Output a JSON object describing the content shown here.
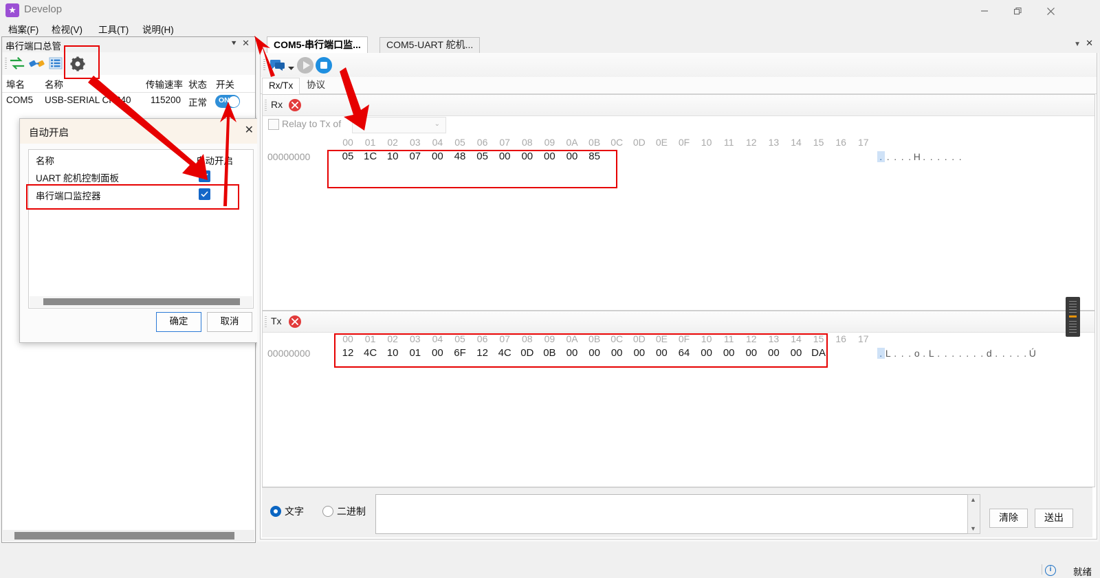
{
  "window": {
    "title": "Develop",
    "logo_icon": "star-logo-icon",
    "minimize_icon": "minimize-icon",
    "maximize_icon": "maximize-icon",
    "close_icon": "close-icon"
  },
  "menubar": {
    "items": [
      {
        "label": "档案(F)",
        "accel": "F"
      },
      {
        "label": "检视(V)",
        "accel": "V"
      },
      {
        "label": "工具(T)",
        "accel": "T"
      },
      {
        "label": "说明(H)",
        "accel": "H"
      }
    ]
  },
  "left_panel": {
    "title": "串行端口总管",
    "pin_icon": "pin-icon",
    "close_icon": "close-icon",
    "toolbar": [
      {
        "name": "refresh-icon",
        "title": "refresh"
      },
      {
        "name": "connect-plug-icon",
        "title": "connect"
      },
      {
        "name": "list-icon",
        "title": "list"
      },
      {
        "name": "gear-icon",
        "title": "settings"
      }
    ],
    "columns": [
      "埠名",
      "名称",
      "传输速率",
      "状态",
      "开关"
    ],
    "rows": [
      {
        "port": "COM5",
        "name": "USB-SERIAL CH340",
        "baud": "115200",
        "state": "正常",
        "switch": "ON"
      }
    ]
  },
  "dialog": {
    "title": "自动开启",
    "close_icon": "close-icon",
    "columns": [
      "名称",
      "自动开启"
    ],
    "items": [
      {
        "name": "UART  舵机控制面板",
        "checked": true
      },
      {
        "name": "串行端口监控器",
        "checked": true
      }
    ],
    "ok_label": "确定",
    "cancel_label": "取消"
  },
  "tabs": {
    "items": [
      {
        "label": "COM5-串行端口监...",
        "active": true
      },
      {
        "label": "COM5-UART 舵机...",
        "active": false
      }
    ],
    "menu_icon": "chevron-down-icon",
    "close_icon": "close-icon"
  },
  "doc_toolbar": [
    {
      "name": "message-icon"
    },
    {
      "name": "chevron-down-icon"
    },
    {
      "name": "play-icon"
    },
    {
      "name": "stop-icon"
    }
  ],
  "inner_tabs": [
    {
      "label": "Rx/Tx",
      "active": true
    },
    {
      "label": "协议",
      "active": false
    }
  ],
  "rx_pane": {
    "label": "Rx",
    "close_icon": "close-circle-icon",
    "relay_label": "Relay to Tx of",
    "relay_checked": false,
    "relay_select_value": "",
    "relay_dropdown_icon": "chevron-down-icon",
    "column_headers": [
      "00",
      "01",
      "02",
      "03",
      "04",
      "05",
      "06",
      "07",
      "08",
      "09",
      "0A",
      "0B",
      "0C",
      "0D",
      "0E",
      "0F",
      "10",
      "11",
      "12",
      "13",
      "14",
      "15",
      "16",
      "17"
    ],
    "offset": "00000000",
    "bytes": [
      "05",
      "1C",
      "10",
      "07",
      "00",
      "48",
      "05",
      "00",
      "00",
      "00",
      "00",
      "85"
    ],
    "ascii": ".....H......",
    "ascii_highlight_index": 0
  },
  "tx_pane": {
    "label": "Tx",
    "close_icon": "close-circle-icon",
    "column_headers": [
      "00",
      "01",
      "02",
      "03",
      "04",
      "05",
      "06",
      "07",
      "08",
      "09",
      "0A",
      "0B",
      "0C",
      "0D",
      "0E",
      "0F",
      "10",
      "11",
      "12",
      "13",
      "14",
      "15",
      "16",
      "17"
    ],
    "offset": "00000000",
    "bytes": [
      "12",
      "4C",
      "10",
      "01",
      "00",
      "6F",
      "12",
      "4C",
      "0D",
      "0B",
      "00",
      "00",
      "00",
      "00",
      "00",
      "64",
      "00",
      "00",
      "00",
      "00",
      "00",
      "DA"
    ],
    "ascii": ".L...o.L.......d.....Ú",
    "ascii_highlight_index": 0
  },
  "send_area": {
    "mode_text_label": "文字",
    "mode_binary_label": "二进制",
    "mode_selected": "文字",
    "input_value": "",
    "clear_label": "清除",
    "send_label": "送出",
    "scroll_up_icon": "triangle-up-icon",
    "scroll_down_icon": "triangle-down-icon"
  },
  "statusbar": {
    "icon": "info-icon",
    "text": "就绪"
  },
  "annotations": {
    "color": "#e60000",
    "arrows": 3,
    "boxes": 4
  }
}
